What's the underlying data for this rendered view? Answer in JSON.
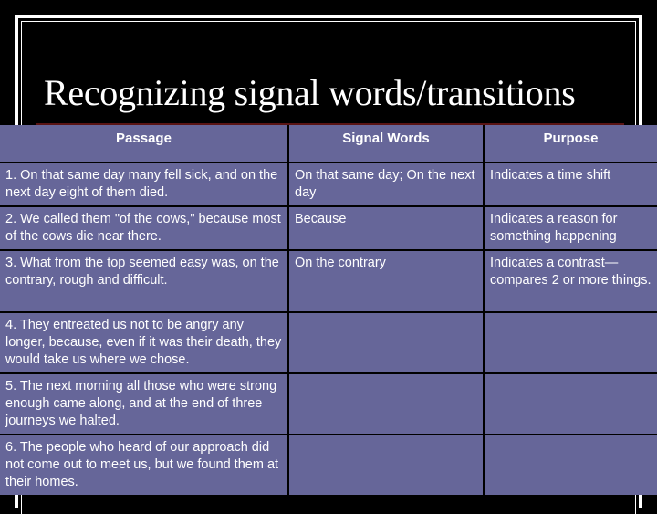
{
  "slide": {
    "title": "Recognizing signal words/transitions"
  },
  "table": {
    "headers": [
      "Passage",
      "Signal Words",
      "Purpose"
    ],
    "rows": [
      {
        "passage": "1. On that same day many fell sick, and on the next day eight of them died.",
        "signal_words": "On that same day; On the next day",
        "purpose": "Indicates a time shift"
      },
      {
        "passage": "2. We called them \"of the cows,\" because most of the cows die near there.",
        "signal_words": "Because",
        "purpose": "Indicates a reason for something happening"
      },
      {
        "passage": "3. What from the top seemed easy was, on the contrary, rough and difficult.",
        "signal_words": "On the contrary",
        "purpose": "Indicates a contrast—compares 2 or more things."
      },
      {
        "passage": "4. They entreated us not to be angry any longer, because, even if it was their death, they would take us where we chose.",
        "signal_words": "",
        "purpose": ""
      },
      {
        "passage": "5. The next morning all those who were strong enough came along, and at the end of three journeys we halted.",
        "signal_words": "",
        "purpose": ""
      },
      {
        "passage": "6. The people who heard of our approach did not come out to meet us, but we found them at their homes.",
        "signal_words": "",
        "purpose": ""
      }
    ]
  },
  "colors": {
    "background": "#000000",
    "table_fill": "#666699",
    "title_rule": "#5a1414",
    "text": "#ffffff"
  }
}
